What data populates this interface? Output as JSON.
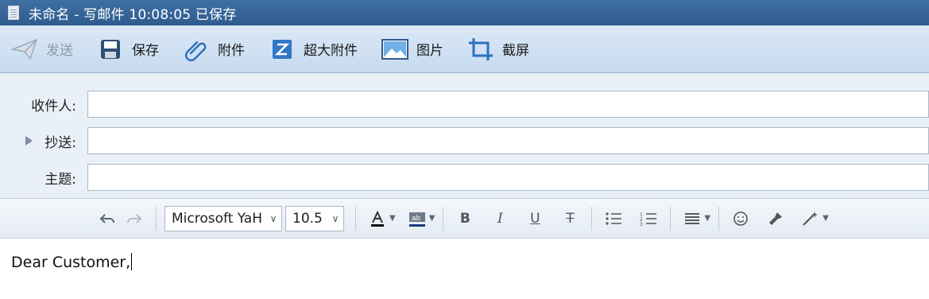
{
  "window": {
    "title": "未命名 - 写邮件    10:08:05 已保存"
  },
  "toolbar": {
    "send": "发送",
    "save": "保存",
    "attachment": "附件",
    "large_attachment": "超大附件",
    "image": "图片",
    "screenshot": "截屏"
  },
  "fields": {
    "to_label": "收件人:",
    "cc_label": "抄送:",
    "subject_label": "主题:",
    "to_value": "",
    "cc_value": "",
    "subject_value": ""
  },
  "format": {
    "font_family": "Microsoft YaH",
    "font_size": "10.5"
  },
  "body": {
    "text": "Dear Customer,"
  }
}
